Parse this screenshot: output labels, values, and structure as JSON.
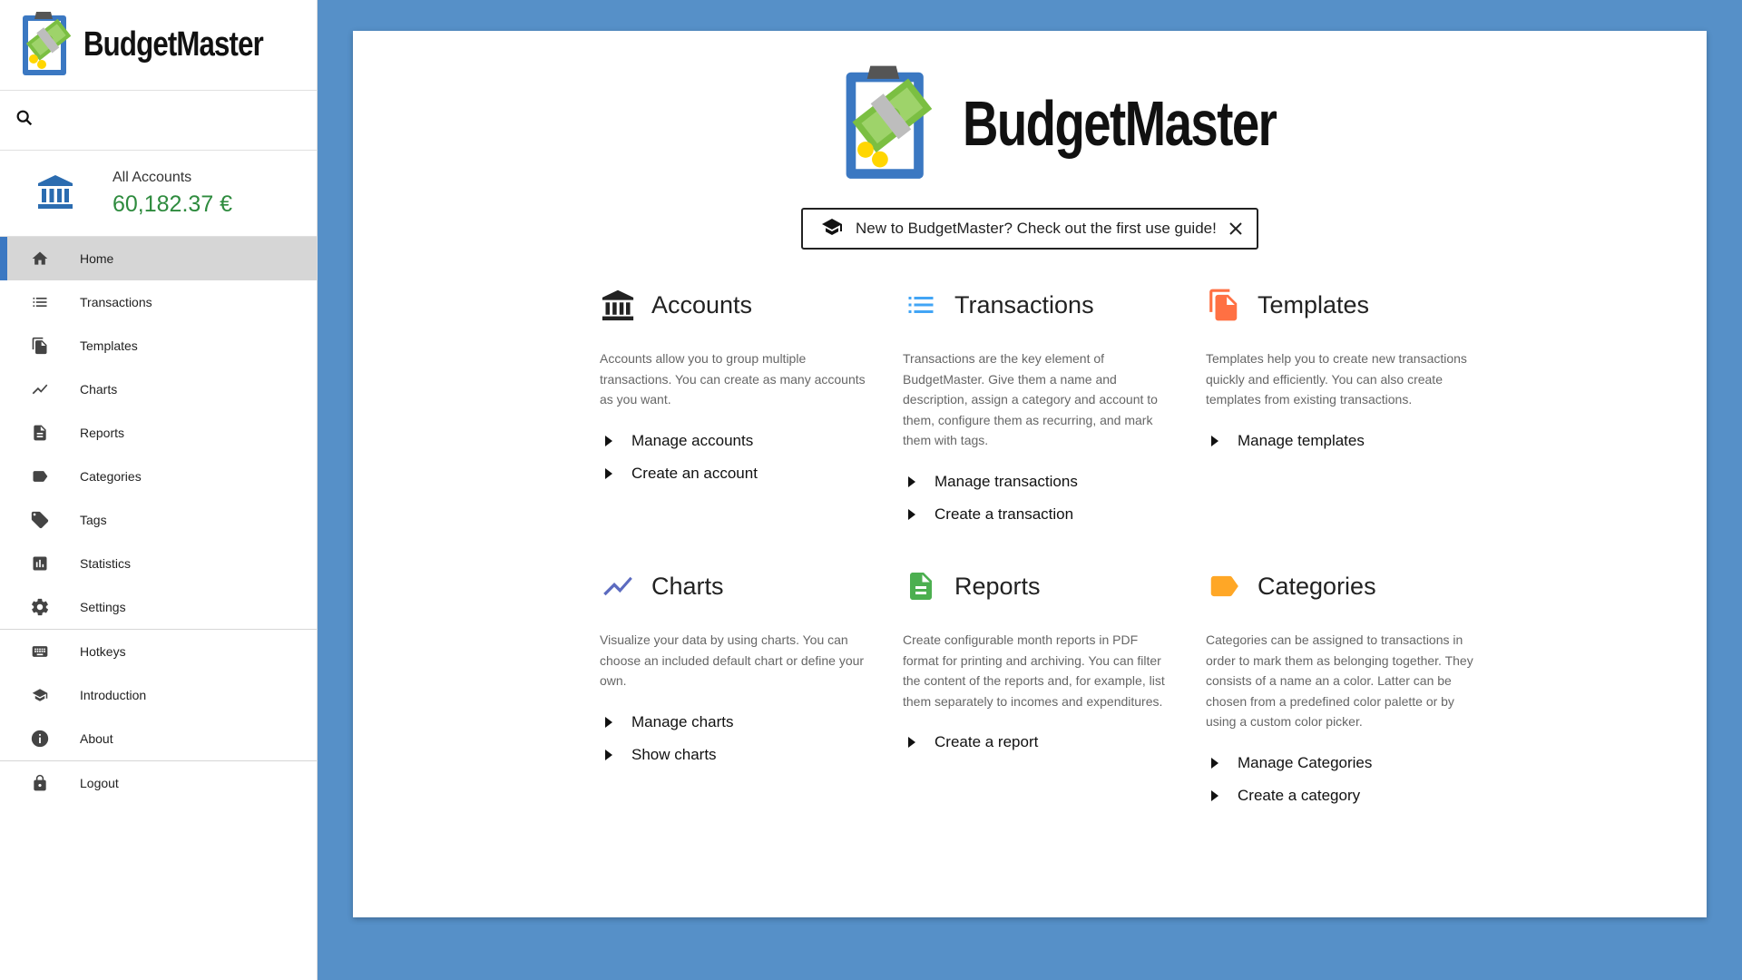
{
  "app": {
    "name": "BudgetMaster"
  },
  "sidebar": {
    "account": {
      "name": "All Accounts",
      "balance": "60,182.37 €"
    },
    "nav": [
      {
        "label": "Home",
        "icon": "home-icon",
        "active": true
      },
      {
        "label": "Transactions",
        "icon": "list-icon"
      },
      {
        "label": "Templates",
        "icon": "file-copy-icon"
      },
      {
        "label": "Charts",
        "icon": "chart-line-icon"
      },
      {
        "label": "Reports",
        "icon": "document-icon"
      },
      {
        "label": "Categories",
        "icon": "label-icon"
      },
      {
        "label": "Tags",
        "icon": "tag-icon"
      },
      {
        "label": "Statistics",
        "icon": "bar-chart-icon"
      },
      {
        "label": "Settings",
        "icon": "gear-icon"
      },
      {
        "label": "Hotkeys",
        "icon": "keyboard-icon"
      },
      {
        "label": "Introduction",
        "icon": "graduation-cap-icon"
      },
      {
        "label": "About",
        "icon": "info-icon"
      },
      {
        "label": "Logout",
        "icon": "lock-icon"
      }
    ]
  },
  "main": {
    "banner": {
      "text": "New to BudgetMaster? Check out the first use guide!"
    },
    "sections": [
      {
        "title": "Accounts",
        "description": "Accounts allow you to group multiple transactions. You can create as many accounts as you want.",
        "links": [
          "Manage accounts",
          "Create an account"
        ],
        "icon": "bank-icon",
        "color": "#222222"
      },
      {
        "title": "Transactions",
        "description": "Transactions are the key element of BudgetMaster. Give them a name and description, assign a category and account to them, configure them as recurring, and mark them with tags.",
        "links": [
          "Manage transactions",
          "Create a transaction"
        ],
        "icon": "list-icon",
        "color": "#42a5f5"
      },
      {
        "title": "Templates",
        "description": "Templates help you to create new transactions quickly and efficiently. You can also create templates from existing transactions.",
        "links": [
          "Manage templates"
        ],
        "icon": "file-copy-icon",
        "color": "#ff7043"
      },
      {
        "title": "Charts",
        "description": "Visualize your data by using charts. You can choose an included default chart or define your own.",
        "links": [
          "Manage charts",
          "Show charts"
        ],
        "icon": "chart-line-icon",
        "color": "#5c6bc0"
      },
      {
        "title": "Reports",
        "description": "Create configurable month reports in PDF format for printing and archiving. You can filter the content of the reports and, for example, list them separately to incomes and expenditures.",
        "links": [
          "Create a report"
        ],
        "icon": "document-icon",
        "color": "#4caf50"
      },
      {
        "title": "Categories",
        "description": "Categories can be assigned to transactions in order to mark them as belonging together. They consists of a name an a color. Latter can be chosen from a predefined color palette or by using a custom color picker.",
        "links": [
          "Manage Categories",
          "Create a category"
        ],
        "icon": "label-icon",
        "color": "#ffa726"
      }
    ]
  }
}
